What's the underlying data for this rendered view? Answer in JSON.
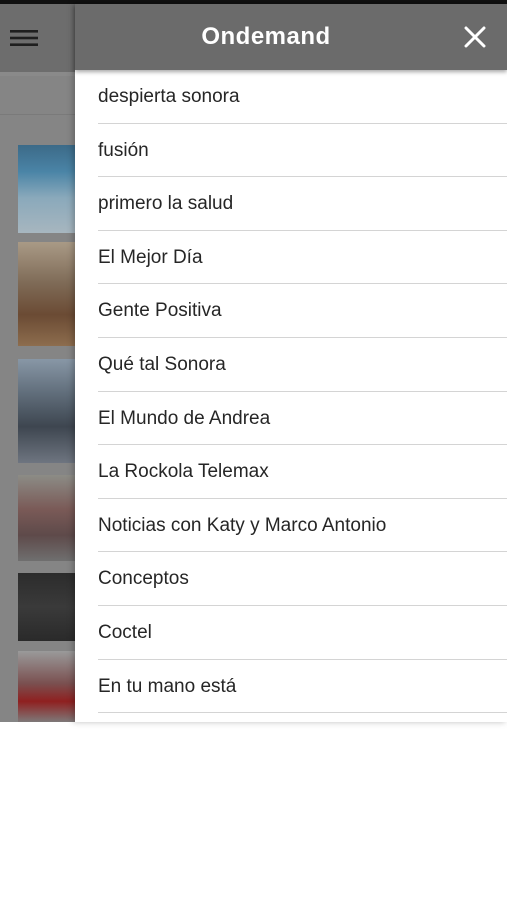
{
  "header": {
    "title": "Ondemand",
    "menu_icon": "hamburger-menu-icon",
    "close_icon": "close-icon"
  },
  "menu": {
    "items": [
      {
        "label": "despierta sonora"
      },
      {
        "label": "fusión"
      },
      {
        "label": "primero la salud"
      },
      {
        "label": "El Mejor Día"
      },
      {
        "label": "Gente Positiva"
      },
      {
        "label": "Qué tal Sonora"
      },
      {
        "label": "El Mundo de Andrea"
      },
      {
        "label": "La Rockola Telemax"
      },
      {
        "label": "Noticias con Katy y Marco Antonio"
      },
      {
        "label": "Conceptos"
      },
      {
        "label": "Coctel"
      },
      {
        "label": "En tu mano está"
      }
    ]
  },
  "colors": {
    "header_bg": "#6b6b6b",
    "overlay_bg": "#858585",
    "text": "#262626",
    "divider": "#d4d4d4"
  }
}
